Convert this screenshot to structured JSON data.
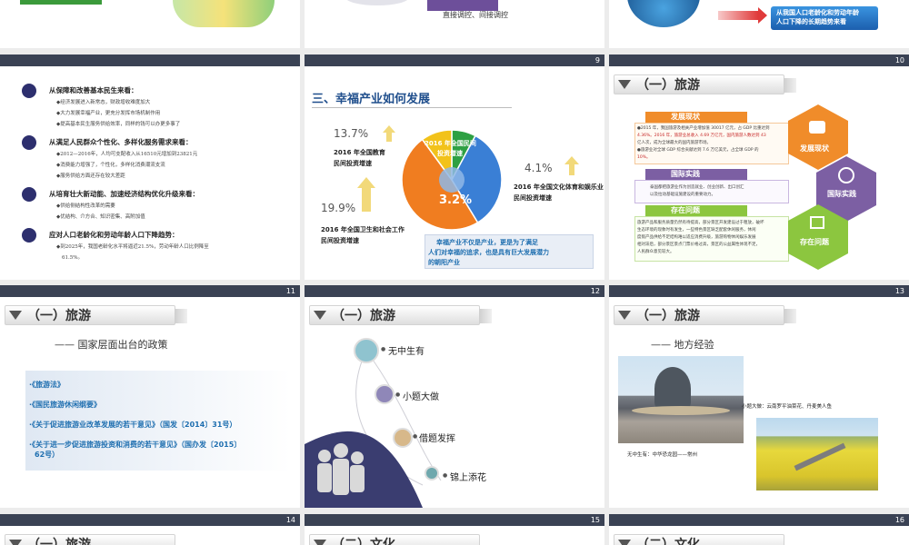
{
  "row0": {
    "s2": {
      "line": "直接调控、间接调控"
    },
    "s3": {
      "banner_line1": "从我国人口老龄化和劳动年龄",
      "banner_line2": "人口下降的长期趋势来看"
    }
  },
  "slide8": {
    "sections": [
      {
        "title": "从保障和改善基本民生来看：",
        "bullets": [
          "◆经济发展进入新常态，财政增收难度加大",
          "◆大力发展幸福产业，更充分发挥市场机制作用",
          "◆提高基本民生服务供给效率，同样的钱可以办更多事了"
        ]
      },
      {
        "title": "从满足人民群众个性化、多样化服务需求来看：",
        "bullets": [
          "◆2012—2016年，人均可支配收入从16510元增加到23821元",
          "◆消费能力增强了，个性化，多样化消费潮流支流",
          "◆服务供给方面还存在较大差距"
        ]
      },
      {
        "title": "从培育壮大新动能、加速经济结构优化升级来看：",
        "bullets": [
          "◆供给侧结构性改革的需要",
          "◆优结构、介方合、知识密集、高附加值"
        ]
      },
      {
        "title": "应对人口老龄化和劳动年龄人口下降趋势：",
        "bullets": [
          "◆到2025年，我国老龄化水平将逼近21.5%，劳动年龄人口比例降至",
          "61.5%。"
        ]
      }
    ]
  },
  "slide9": {
    "num": "9",
    "title": "三、幸福产业如何发展",
    "pct_left_top": "13.7%",
    "label_left_top_1": "2016 年全国教育",
    "label_left_top_2": "民间投资增速",
    "pct_left_bot": "19.9%",
    "label_left_bot_1": "2016 年全国卫生和社会工作",
    "label_left_bot_2": "民间投资增速",
    "pct_right": "4.1%",
    "label_right_1": "2016 年全国文化体育和娱乐业",
    "label_right_2": "民间投资增速",
    "center_label_1": "2016 年全国民间",
    "center_label_2": "投资增速",
    "center_pct": "3.2%",
    "note_1": "幸福产业不仅是产业，更是为了满足",
    "note_2": "人们对幸福的追求，也是具有巨大发展潜力",
    "note_3": "的朝阳产业",
    "chart_data": {
      "type": "pie",
      "categories": [
        "2016 年全国民间投资增速",
        "2016 年全国教育民间投资增速",
        "2016 年全国卫生和社会工作民间投资增速",
        "2016 年全国文化体育和娱乐业民间投资增速"
      ],
      "values": [
        3.2,
        13.7,
        19.9,
        4.1
      ]
    }
  },
  "slide10": {
    "num": "10",
    "title": "（一）旅游",
    "tab1": "发展现状",
    "tab2": "国际实践",
    "tab3": "存在问题",
    "p1_l1": "●2015 年，我国旅游及相关产业增加值 30017 亿元，占 GDP 比重达到",
    "p1_l2": "4.36%。2016 年，旅游业总收入 4.69 万亿元，国内旅游人数达到 43",
    "p1_l3": "亿人次，成为全球最大的国内旅游市场。",
    "p1_l4": "●旅游业对全球 GDP 综合贡献达到 7.6 万亿美元，占全球 GDP 的",
    "p1_l5": "10%。",
    "p2_l1": "泰国都把旅游业作为创造就业、创业创新、出口创汇",
    "p2_l2": "以及拉动基础设施建设的重要动力。",
    "p3_l1": "旅游产品和服务质量仍然有待提高，部分景区开发建设过于粗放，破坏",
    "p3_l2": "生态环境的现象时有发生，一些特色景区缺乏配套休闲服务，休闲",
    "p3_l3": "度假产品供给不足结构难以适应消费升级，旅游购物休闲娱乐发展",
    "p3_l4": "相对滞后，部分景区景点门票价格过高，景区的公益属性体现不足，",
    "p3_l5": "人民群众意见较大。",
    "hex1": "发展现状",
    "hex2": "国际实践",
    "hex3": "存在问题"
  },
  "slide11": {
    "num": "11",
    "title": "（一）旅游",
    "subtitle": "—— 国家层面出台的政策",
    "items": [
      "·《旅游法》",
      "·《国民旅游休闲纲要》",
      "·《关于促进旅游业改革发展的若干意见》（国发〔2014〕31号）",
      "·《关于进一步促进旅游投资和消费的若干意见》（国办发〔2015〕",
      "62号）"
    ]
  },
  "slide12": {
    "num": "12",
    "title": "（一）旅游",
    "items": [
      "无中生有",
      "小题大做",
      "借题发挥",
      "锦上添花"
    ]
  },
  "slide13": {
    "num": "13",
    "title": "（一）旅游",
    "subtitle": "—— 地方经验",
    "cap_left": "无中生有：中华恐龙园——常州",
    "cap_right": "小题大做：云南罗平油菜花、丹麦美人鱼"
  },
  "row4": {
    "n14": "14",
    "n15": "15",
    "n16": "16",
    "t14": "（一）旅游",
    "t15": "（二）文化",
    "t16": "（二）文化"
  },
  "colors": {
    "navy": "#2d2f6e",
    "bar": "#3a4254",
    "blue": "#1f6fb0",
    "orange": "#f08c2a",
    "purple": "#7c5fa3",
    "green": "#8cc63f"
  }
}
